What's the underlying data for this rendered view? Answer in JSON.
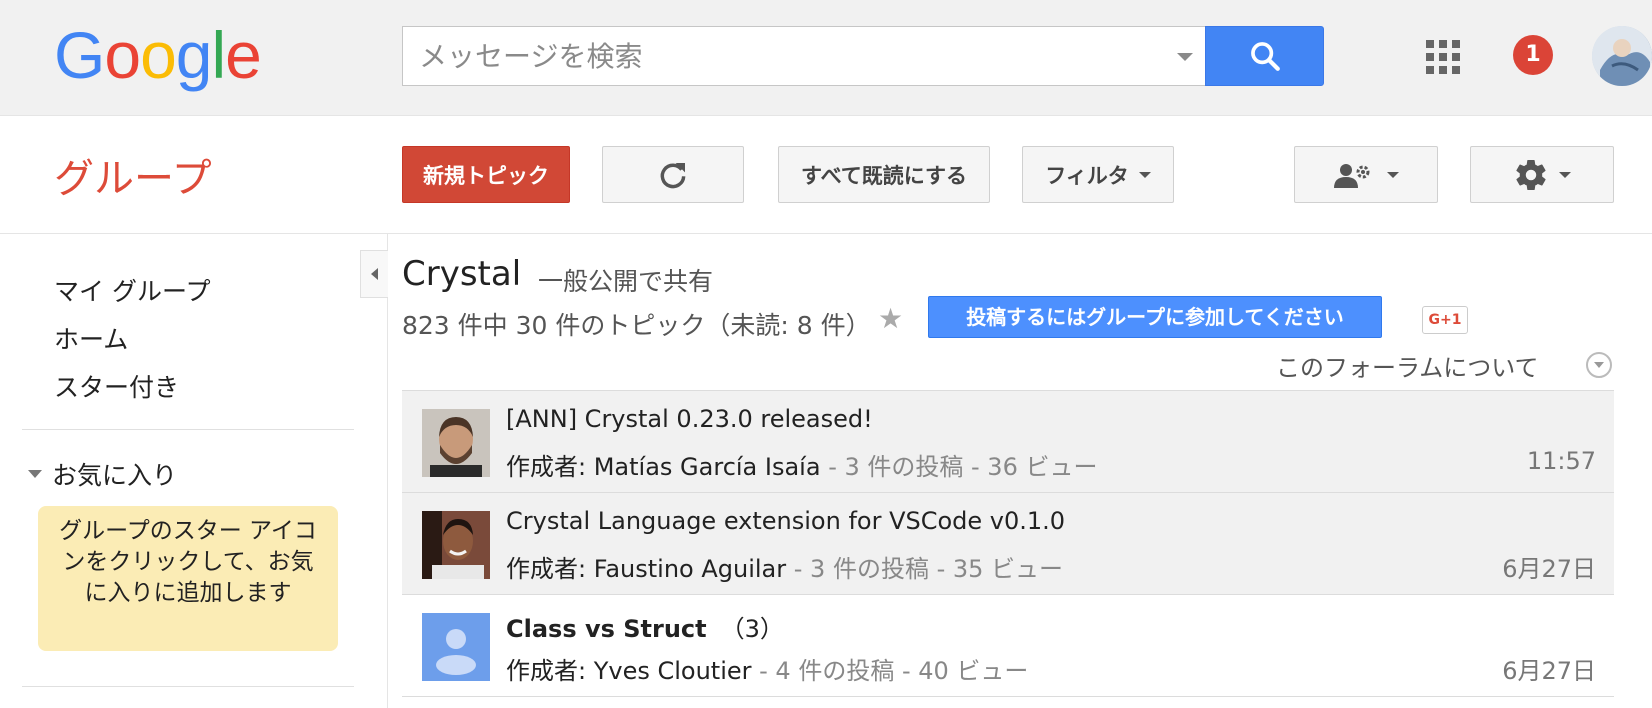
{
  "header": {
    "logo_letters": [
      {
        "ch": "G",
        "color": "#4285f4"
      },
      {
        "ch": "o",
        "color": "#ea4335"
      },
      {
        "ch": "o",
        "color": "#fbbc05"
      },
      {
        "ch": "g",
        "color": "#4285f4"
      },
      {
        "ch": "l",
        "color": "#34a853"
      },
      {
        "ch": "e",
        "color": "#ea4335"
      }
    ],
    "search_placeholder": "メッセージを検索",
    "notification_count": "1"
  },
  "toolbar": {
    "app_title": "グループ",
    "new_topic_label": "新規トピック",
    "mark_all_read_label": "すべて既読にする",
    "filter_label": "フィルタ"
  },
  "sidebar": {
    "nav_items": [
      "マイ グループ",
      "ホーム",
      "スター付き"
    ],
    "favorites_label": "お気に入り",
    "favorites_note": "グループのスター アイコンをクリックして、お気に入りに追加します"
  },
  "forum": {
    "name": "Crystal",
    "share": "一般公開で共有",
    "topic_count": "823 件中 30 件のトピック（未読: 8 件）",
    "join_banner": "投稿するにはグループに参加してください",
    "gplus_label": "G+1",
    "about_label": "このフォーラムについて"
  },
  "topics": [
    {
      "title": "[ANN] Crystal 0.23.0 released!",
      "count": "",
      "author_prefix": "作成者: ",
      "author": "Matías García Isaía",
      "stats": " - 3 件の投稿 - 36 ビュー",
      "date": "11:57",
      "unread": false
    },
    {
      "title": "Crystal Language extension for VSCode v0.1.0",
      "count": "",
      "author_prefix": "作成者: ",
      "author": "Faustino Aguilar",
      "stats": " - 3 件の投稿 - 35 ビュー",
      "date": "6月27日",
      "unread": false
    },
    {
      "title": "Class vs Struct",
      "count": "（3）",
      "author_prefix": "作成者: ",
      "author": "Yves Cloutier",
      "stats": " - 4 件の投稿 - 40 ビュー",
      "date": "6月27日",
      "unread": true
    }
  ]
}
